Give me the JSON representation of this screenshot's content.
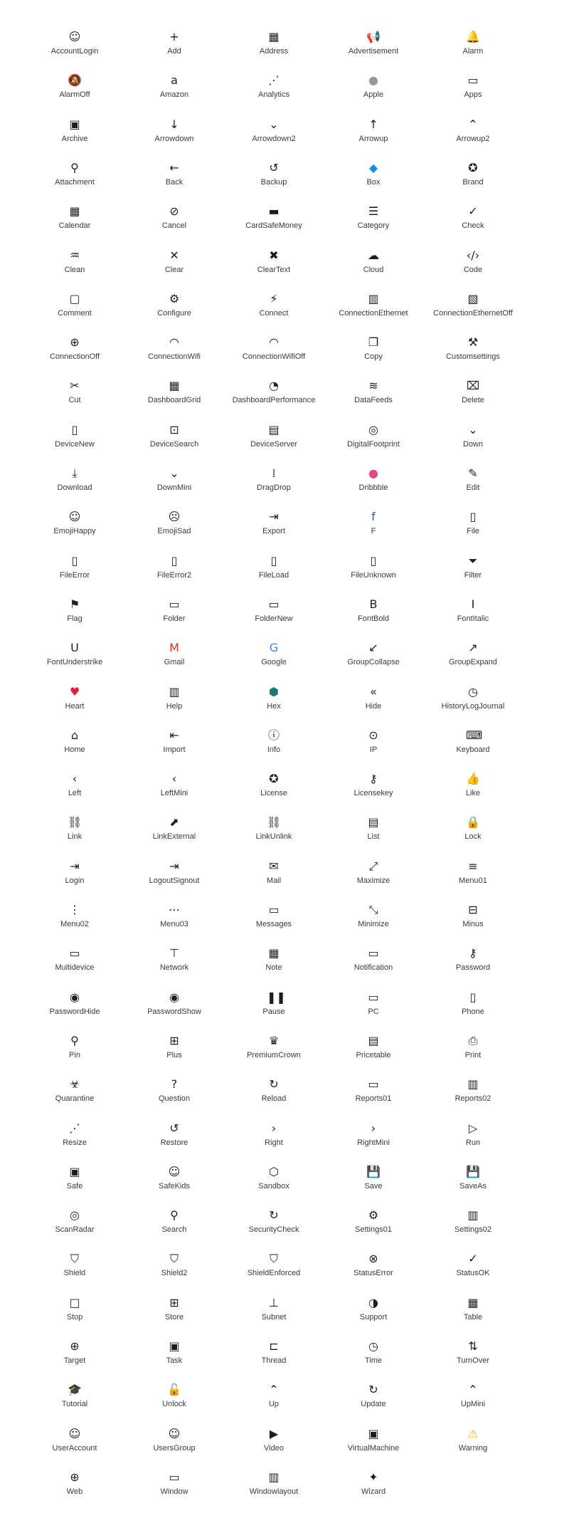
{
  "icons": [
    {
      "name": "AccountLogin",
      "glyph": "☺"
    },
    {
      "name": "Add",
      "glyph": "+"
    },
    {
      "name": "Address",
      "glyph": "▦"
    },
    {
      "name": "Advertisement",
      "glyph": "📢"
    },
    {
      "name": "Alarm",
      "glyph": "🔔"
    },
    {
      "name": "AlarmOff",
      "glyph": "🔕"
    },
    {
      "name": "Amazon",
      "glyph": "a"
    },
    {
      "name": "Analytics",
      "glyph": "⋰"
    },
    {
      "name": "Apple",
      "glyph": "●",
      "color": "#999999"
    },
    {
      "name": "Apps",
      "glyph": "▭"
    },
    {
      "name": "Archive",
      "glyph": "▣"
    },
    {
      "name": "Arrowdown",
      "glyph": "↓"
    },
    {
      "name": "Arrowdown2",
      "glyph": "⌄"
    },
    {
      "name": "Arrowup",
      "glyph": "↑"
    },
    {
      "name": "Arrowup2",
      "glyph": "⌃"
    },
    {
      "name": "Attachment",
      "glyph": "⚲"
    },
    {
      "name": "Back",
      "glyph": "←"
    },
    {
      "name": "Backup",
      "glyph": "↺"
    },
    {
      "name": "Box",
      "glyph": "◆",
      "color": "#1d8ede"
    },
    {
      "name": "Brand",
      "glyph": "✪"
    },
    {
      "name": "Calendar",
      "glyph": "▦"
    },
    {
      "name": "Cancel",
      "glyph": "⊘"
    },
    {
      "name": "CardSafeMoney",
      "glyph": "▬"
    },
    {
      "name": "Category",
      "glyph": "☰"
    },
    {
      "name": "Check",
      "glyph": "✓"
    },
    {
      "name": "Clean",
      "glyph": "♒"
    },
    {
      "name": "Clear",
      "glyph": "✕"
    },
    {
      "name": "ClearText",
      "glyph": "✖"
    },
    {
      "name": "Cloud",
      "glyph": "☁"
    },
    {
      "name": "Code",
      "glyph": "‹/›"
    },
    {
      "name": "Comment",
      "glyph": "▢"
    },
    {
      "name": "Configure",
      "glyph": "⚙"
    },
    {
      "name": "Connect",
      "glyph": "⚡"
    },
    {
      "name": "ConnectionEthernet",
      "glyph": "▥"
    },
    {
      "name": "ConnectionEthernetOff",
      "glyph": "▧"
    },
    {
      "name": "ConnectionOff",
      "glyph": "⊕"
    },
    {
      "name": "ConnectionWifi",
      "glyph": "◠"
    },
    {
      "name": "ConnectionWifiOff",
      "glyph": "◠"
    },
    {
      "name": "Copy",
      "glyph": "❐"
    },
    {
      "name": "Customsettings",
      "glyph": "⚒"
    },
    {
      "name": "Cut",
      "glyph": "✂"
    },
    {
      "name": "DashboardGrid",
      "glyph": "▦"
    },
    {
      "name": "DashboardPerformance",
      "glyph": "◔"
    },
    {
      "name": "DataFeeds",
      "glyph": "≋"
    },
    {
      "name": "Delete",
      "glyph": "⌧"
    },
    {
      "name": "DeviceNew",
      "glyph": "▯"
    },
    {
      "name": "DeviceSearch",
      "glyph": "⊡"
    },
    {
      "name": "DeviceServer",
      "glyph": "▤"
    },
    {
      "name": "DigitalFootprint",
      "glyph": "◎"
    },
    {
      "name": "Down",
      "glyph": "⌄"
    },
    {
      "name": "Download",
      "glyph": "⤓"
    },
    {
      "name": "DownMini",
      "glyph": "⌄"
    },
    {
      "name": "DragDrop",
      "glyph": "⁞"
    },
    {
      "name": "Dribbble",
      "glyph": "●",
      "color": "#e24a85"
    },
    {
      "name": "Edit",
      "glyph": "✎"
    },
    {
      "name": "EmojiHappy",
      "glyph": "☺"
    },
    {
      "name": "EmojiSad",
      "glyph": "☹"
    },
    {
      "name": "Export",
      "glyph": "⇥"
    },
    {
      "name": "F",
      "glyph": "f",
      "color": "#3b5998"
    },
    {
      "name": "File",
      "glyph": "▯"
    },
    {
      "name": "FileError",
      "glyph": "▯"
    },
    {
      "name": "FileError2",
      "glyph": "▯"
    },
    {
      "name": "FileLoad",
      "glyph": "▯"
    },
    {
      "name": "FileUnknown",
      "glyph": "▯"
    },
    {
      "name": "Filter",
      "glyph": "⏷"
    },
    {
      "name": "Flag",
      "glyph": "⚑"
    },
    {
      "name": "Folder",
      "glyph": "▭"
    },
    {
      "name": "FolderNew",
      "glyph": "▭"
    },
    {
      "name": "FontBold",
      "glyph": "B"
    },
    {
      "name": "FontItalic",
      "glyph": "I"
    },
    {
      "name": "FontUnderstrike",
      "glyph": "U"
    },
    {
      "name": "Gmail",
      "glyph": "M",
      "color": "#d93025"
    },
    {
      "name": "Google",
      "glyph": "G",
      "color": "#4285f4"
    },
    {
      "name": "GroupCollapse",
      "glyph": "↙"
    },
    {
      "name": "GroupExpand",
      "glyph": "↗"
    },
    {
      "name": "Heart",
      "glyph": "♥",
      "color": "#e0203a"
    },
    {
      "name": "Help",
      "glyph": "▥"
    },
    {
      "name": "Hex",
      "glyph": "⬢",
      "color": "#1d7a6a"
    },
    {
      "name": "Hide",
      "glyph": "«"
    },
    {
      "name": "HistoryLogJournal",
      "glyph": "◷"
    },
    {
      "name": "Home",
      "glyph": "⌂"
    },
    {
      "name": "Import",
      "glyph": "⇤"
    },
    {
      "name": "Info",
      "glyph": "ⓘ"
    },
    {
      "name": "IP",
      "glyph": "⊙"
    },
    {
      "name": "Keyboard",
      "glyph": "⌨"
    },
    {
      "name": "Left",
      "glyph": "‹"
    },
    {
      "name": "LeftMini",
      "glyph": "‹"
    },
    {
      "name": "License",
      "glyph": "✪"
    },
    {
      "name": "Licensekey",
      "glyph": "⚷"
    },
    {
      "name": "Like",
      "glyph": "👍"
    },
    {
      "name": "Link",
      "glyph": "⛓"
    },
    {
      "name": "LinkExternal",
      "glyph": "⬈"
    },
    {
      "name": "LinkUnlink",
      "glyph": "⛓"
    },
    {
      "name": "List",
      "glyph": "▤"
    },
    {
      "name": "Lock",
      "glyph": "🔒"
    },
    {
      "name": "Login",
      "glyph": "⇥"
    },
    {
      "name": "LogoutSignout",
      "glyph": "⇥"
    },
    {
      "name": "Mail",
      "glyph": "✉"
    },
    {
      "name": "Maximize",
      "glyph": "⤢"
    },
    {
      "name": "Menu01",
      "glyph": "≡"
    },
    {
      "name": "Menu02",
      "glyph": "⋮"
    },
    {
      "name": "Menu03",
      "glyph": "⋯"
    },
    {
      "name": "Messages",
      "glyph": "▭"
    },
    {
      "name": "Minimize",
      "glyph": "⤡"
    },
    {
      "name": "Minus",
      "glyph": "⊟"
    },
    {
      "name": "Multidevice",
      "glyph": "▭"
    },
    {
      "name": "Network",
      "glyph": "⊤"
    },
    {
      "name": "Note",
      "glyph": "▦"
    },
    {
      "name": "Notification",
      "glyph": "▭"
    },
    {
      "name": "Password",
      "glyph": "⚷"
    },
    {
      "name": "PasswordHide",
      "glyph": "◉"
    },
    {
      "name": "PasswordShow",
      "glyph": "◉"
    },
    {
      "name": "Pause",
      "glyph": "❚❚"
    },
    {
      "name": "PC",
      "glyph": "▭"
    },
    {
      "name": "Phone",
      "glyph": "▯"
    },
    {
      "name": "Pin",
      "glyph": "⚲"
    },
    {
      "name": "Plus",
      "glyph": "⊞"
    },
    {
      "name": "PremiumCrown",
      "glyph": "♛"
    },
    {
      "name": "Pricetable",
      "glyph": "▤"
    },
    {
      "name": "Print",
      "glyph": "⎙"
    },
    {
      "name": "Quarantine",
      "glyph": "☣"
    },
    {
      "name": "Question",
      "glyph": "?"
    },
    {
      "name": "Reload",
      "glyph": "↻"
    },
    {
      "name": "Reports01",
      "glyph": "▭"
    },
    {
      "name": "Reports02",
      "glyph": "▥"
    },
    {
      "name": "Resize",
      "glyph": "⋰"
    },
    {
      "name": "Restore",
      "glyph": "↺"
    },
    {
      "name": "Right",
      "glyph": "›"
    },
    {
      "name": "RightMini",
      "glyph": "›"
    },
    {
      "name": "Run",
      "glyph": "▷"
    },
    {
      "name": "Safe",
      "glyph": "▣"
    },
    {
      "name": "SafeKids",
      "glyph": "☺"
    },
    {
      "name": "Sandbox",
      "glyph": "⬡"
    },
    {
      "name": "Save",
      "glyph": "💾"
    },
    {
      "name": "SaveAs",
      "glyph": "💾"
    },
    {
      "name": "ScanRadar",
      "glyph": "◎"
    },
    {
      "name": "Search",
      "glyph": "⚲"
    },
    {
      "name": "SecurityCheck",
      "glyph": "↻"
    },
    {
      "name": "Settings01",
      "glyph": "⚙"
    },
    {
      "name": "Settings02",
      "glyph": "▥"
    },
    {
      "name": "Shield",
      "glyph": "⛉"
    },
    {
      "name": "Shield2",
      "glyph": "⛉"
    },
    {
      "name": "ShieldEnforced",
      "glyph": "⛉"
    },
    {
      "name": "StatusError",
      "glyph": "⊗"
    },
    {
      "name": "StatusOK",
      "glyph": "✓"
    },
    {
      "name": "Stop",
      "glyph": "□"
    },
    {
      "name": "Store",
      "glyph": "⊞"
    },
    {
      "name": "Subnet",
      "glyph": "⊥"
    },
    {
      "name": "Support",
      "glyph": "◑"
    },
    {
      "name": "Table",
      "glyph": "▦"
    },
    {
      "name": "Target",
      "glyph": "⊕"
    },
    {
      "name": "Task",
      "glyph": "▣"
    },
    {
      "name": "Thread",
      "glyph": "⊏"
    },
    {
      "name": "Time",
      "glyph": "◷"
    },
    {
      "name": "TurnOver",
      "glyph": "⇅"
    },
    {
      "name": "Tutorial",
      "glyph": "🎓"
    },
    {
      "name": "Unlock",
      "glyph": "🔓"
    },
    {
      "name": "Up",
      "glyph": "⌃"
    },
    {
      "name": "Update",
      "glyph": "↻"
    },
    {
      "name": "UpMini",
      "glyph": "⌃"
    },
    {
      "name": "UserAccount",
      "glyph": "☺"
    },
    {
      "name": "UsersGroup",
      "glyph": "☺"
    },
    {
      "name": "Video",
      "glyph": "▶"
    },
    {
      "name": "VirtualMachine",
      "glyph": "▣"
    },
    {
      "name": "Warning",
      "glyph": "⚠",
      "color": "#f2b21b"
    },
    {
      "name": "Web",
      "glyph": "⊕"
    },
    {
      "name": "Window",
      "glyph": "▭"
    },
    {
      "name": "Windowlayout",
      "glyph": "▥"
    },
    {
      "name": "Wizard",
      "glyph": "✦"
    }
  ]
}
